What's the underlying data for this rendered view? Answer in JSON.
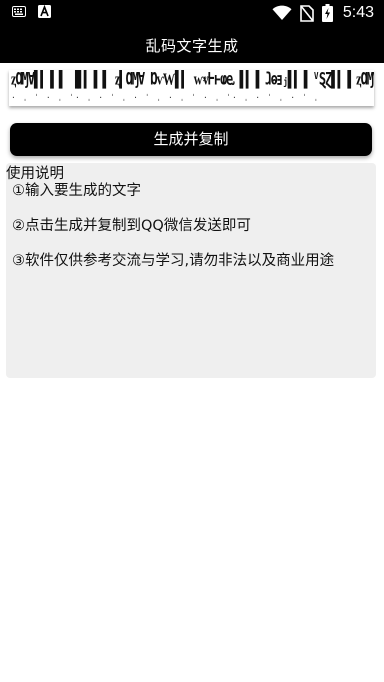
{
  "status_bar": {
    "time": "5:43",
    "left_icons": [
      "keyboard-icon",
      "font-a-icon"
    ],
    "right_icons": [
      "wifi-icon",
      "no-sim-icon",
      "battery-charging-icon"
    ],
    "notification_letter": "A"
  },
  "toolbar": {
    "title": "乱码文字生成",
    "background": "#000000"
  },
  "garbled_output": {
    "text": "ⱬⱭⱮⱯ▌▍▐ ▌ ▐▌▍▐ ▌ ⱬ▍ⱭⱮⱯ ⱰⱱⱲ▌▍ ⱳⱴⱵⱶⱷⱸ ▌▍▐ ⱹⱺⱻⱼ▌▍▐ ⱽⱾⱿ▌▍▐ ⱬⱭⱮⱯ▌▐▌",
    "marks": "· ˌ ˈ · ˌ ˈ· ˌ · ˈ ˌ · ˈ ˌ · ˌ ˈ · ˌ ˈ· ˌ · ˈ ˌ · ˈ ˌ"
  },
  "actions": {
    "generate_copy_label": "生成并复制"
  },
  "instructions": {
    "heading": "使用说明",
    "items": [
      "①输入要生成的文字",
      "②点击生成并复制到QQ微信发送即可",
      "③软件仅供参考交流与学习,请勿非法以及商业用途"
    ],
    "panel_color": "#efefef"
  }
}
